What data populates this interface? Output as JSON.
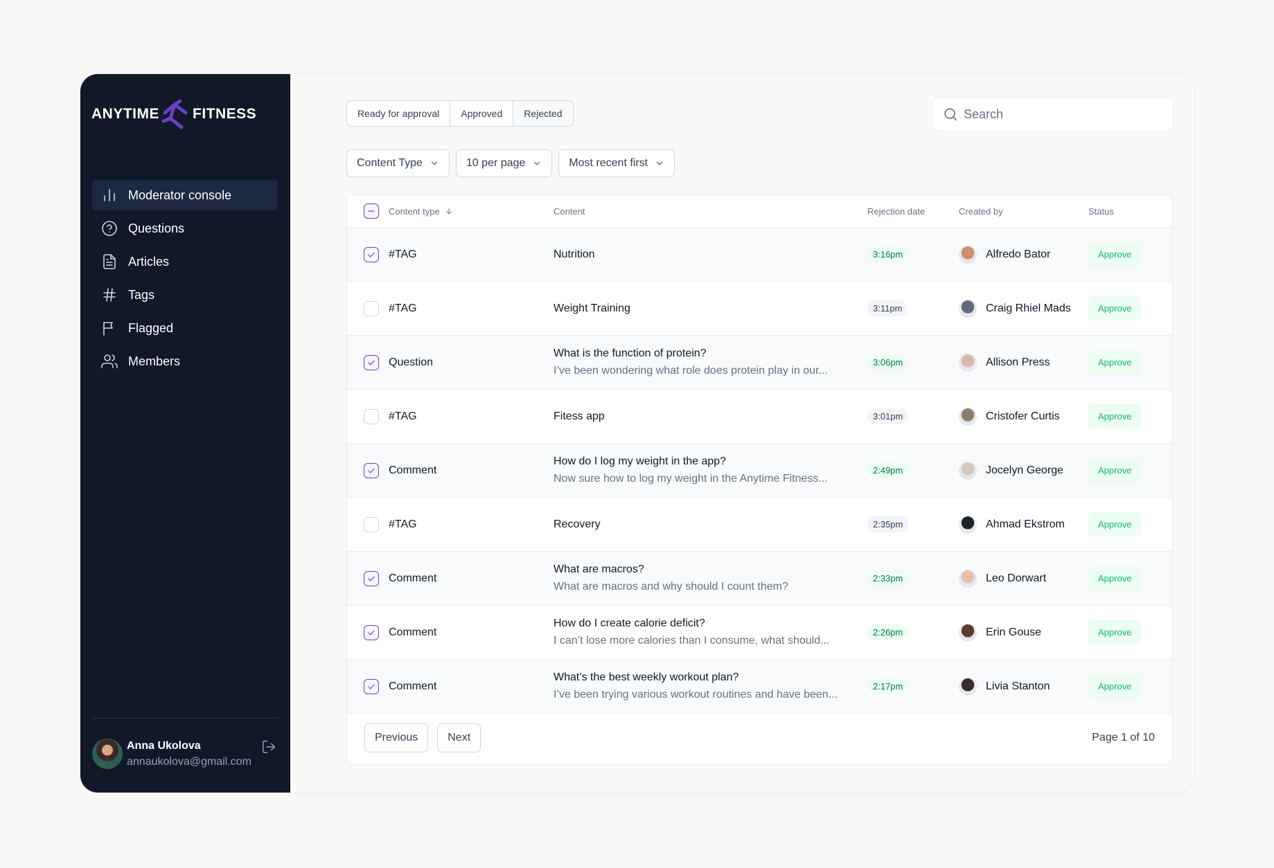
{
  "brand": {
    "left": "ANYTIME",
    "right": "FITNESS",
    "accent": "#6941c6"
  },
  "nav": [
    {
      "label": "Moderator console",
      "icon": "bar-chart-icon",
      "active": true
    },
    {
      "label": "Questions",
      "icon": "help-circle-icon",
      "active": false
    },
    {
      "label": "Articles",
      "icon": "file-text-icon",
      "active": false
    },
    {
      "label": "Tags",
      "icon": "hash-icon",
      "active": false
    },
    {
      "label": "Flagged",
      "icon": "flag-icon",
      "active": false
    },
    {
      "label": "Members",
      "icon": "users-icon",
      "active": false
    }
  ],
  "user": {
    "name": "Anna Ukolova",
    "email": "annaukolova@gmail.com"
  },
  "tabs": [
    {
      "label": "Ready for approval",
      "active": false
    },
    {
      "label": "Approved",
      "active": false
    },
    {
      "label": "Rejected",
      "active": true
    }
  ],
  "search": {
    "placeholder": "Search",
    "value": ""
  },
  "filters": [
    {
      "label": "Content Type"
    },
    {
      "label": "10 per page"
    },
    {
      "label": "Most recent first"
    }
  ],
  "columns": {
    "type": "Content type",
    "content": "Content",
    "date": "Rejection date",
    "by": "Created by",
    "status": "Status"
  },
  "rows": [
    {
      "checked": true,
      "type": "#TAG",
      "title": "Nutrition",
      "sub": "",
      "time": "3:16pm",
      "time_style": "green",
      "by": "Alfredo Bator",
      "status": "Approve",
      "avatar": "#c98f6f"
    },
    {
      "checked": false,
      "type": "#TAG",
      "title": "Weight Training",
      "sub": "",
      "time": "3:11pm",
      "time_style": "gray",
      "by": "Craig Rhiel Mads",
      "status": "Approve",
      "avatar": "#5f6b7a"
    },
    {
      "checked": true,
      "type": "Question",
      "title": "What is the function of protein?",
      "sub": "I’ve been wondering what role does protein play in our...",
      "time": "3:06pm",
      "time_style": "green",
      "by": "Allison Press",
      "status": "Approve",
      "avatar": "#d9b8a8"
    },
    {
      "checked": false,
      "type": "#TAG",
      "title": "Fitess app",
      "sub": "",
      "time": "3:01pm",
      "time_style": "gray",
      "by": "Cristofer Curtis",
      "status": "Approve",
      "avatar": "#8a7f6a"
    },
    {
      "checked": true,
      "type": "Comment",
      "title": "How do I log my weight in the app?",
      "sub": "Now sure how to log my weight in the Anytime Fitness...",
      "time": "2:49pm",
      "time_style": "green",
      "by": "Jocelyn George",
      "status": "Approve",
      "avatar": "#d6c7bd"
    },
    {
      "checked": false,
      "type": "#TAG",
      "title": "Recovery",
      "sub": "",
      "time": "2:35pm",
      "time_style": "gray",
      "by": "Ahmad Ekstrom",
      "status": "Approve",
      "avatar": "#1f2328"
    },
    {
      "checked": true,
      "type": "Comment",
      "title": "What are macros?",
      "sub": "What are macros and why should I count them?",
      "time": "2:33pm",
      "time_style": "green",
      "by": "Leo Dorwart",
      "status": "Approve",
      "avatar": "#e2c2ad"
    },
    {
      "checked": true,
      "type": "Comment",
      "title": "How do I create calorie deficit?",
      "sub": "I can’t lose more calories than I consume, what should...",
      "time": "2:26pm",
      "time_style": "green",
      "by": "Erin Gouse",
      "status": "Approve",
      "avatar": "#5b3b2e"
    },
    {
      "checked": true,
      "type": "Comment",
      "title": "What’s the best weekly workout plan?",
      "sub": "I’ve been trying various workout routines and have been...",
      "time": "2:17pm",
      "time_style": "green",
      "by": "Livia Stanton",
      "status": "Approve",
      "avatar": "#3a2c2a"
    }
  ],
  "pagination": {
    "previous": "Previous",
    "next": "Next",
    "info": "Page 1 of 10"
  }
}
